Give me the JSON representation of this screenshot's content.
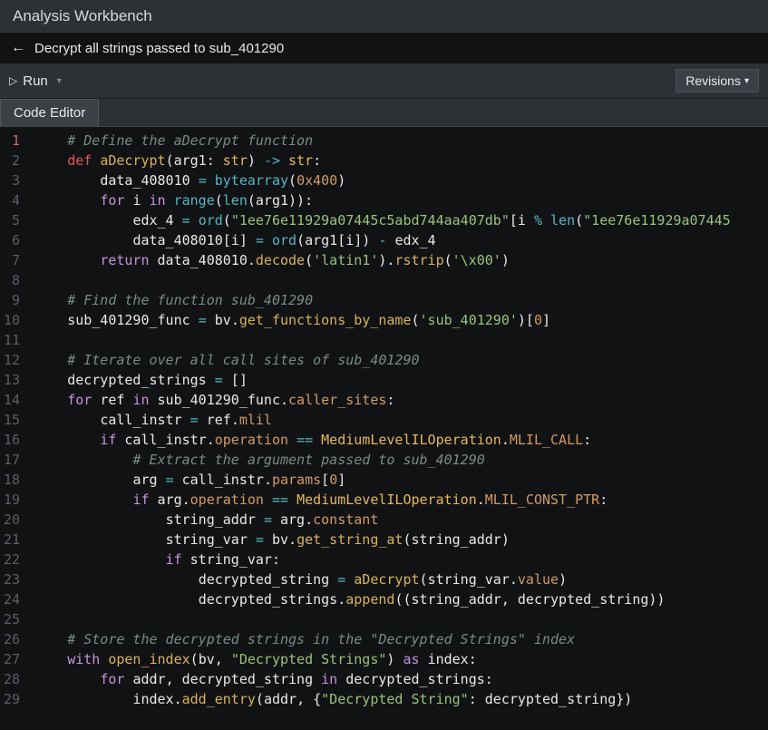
{
  "window": {
    "title": "Analysis Workbench"
  },
  "breadcrumb": {
    "text": "Decrypt all strings passed to sub_401290"
  },
  "toolbar": {
    "run_label": "Run",
    "revisions_label": "Revisions"
  },
  "tabs": {
    "code_editor": "Code Editor"
  },
  "code": {
    "lines": [
      {
        "n": 1,
        "tokens": [
          [
            "    ",
            ""
          ],
          [
            "# Define the aDecrypt function",
            "cmt"
          ]
        ]
      },
      {
        "n": 2,
        "tokens": [
          [
            "    ",
            ""
          ],
          [
            "def",
            "kw"
          ],
          [
            " ",
            ""
          ],
          [
            "aDecrypt",
            "fn"
          ],
          [
            "(",
            "pn"
          ],
          [
            "arg1",
            "nm"
          ],
          [
            ": ",
            "pn"
          ],
          [
            "str",
            "ty"
          ],
          [
            ") ",
            "pn"
          ],
          [
            "->",
            "op"
          ],
          [
            " ",
            ""
          ],
          [
            "str",
            "ty"
          ],
          [
            ":",
            "pn"
          ]
        ]
      },
      {
        "n": 3,
        "tokens": [
          [
            "        ",
            ""
          ],
          [
            "data_408010 ",
            "nm"
          ],
          [
            "=",
            "op"
          ],
          [
            " ",
            ""
          ],
          [
            "bytearray",
            "bi"
          ],
          [
            "(",
            "pn"
          ],
          [
            "0x400",
            "num"
          ],
          [
            ")",
            "pn"
          ]
        ]
      },
      {
        "n": 4,
        "tokens": [
          [
            "        ",
            ""
          ],
          [
            "for",
            "kw2"
          ],
          [
            " ",
            ""
          ],
          [
            "i",
            "nm"
          ],
          [
            " ",
            ""
          ],
          [
            "in",
            "kw2"
          ],
          [
            " ",
            ""
          ],
          [
            "range",
            "bi"
          ],
          [
            "(",
            "pn"
          ],
          [
            "len",
            "bi"
          ],
          [
            "(",
            "pn"
          ],
          [
            "arg1",
            "nm"
          ],
          [
            "))",
            "pn"
          ],
          [
            ":",
            "pn"
          ]
        ]
      },
      {
        "n": 5,
        "tokens": [
          [
            "            ",
            ""
          ],
          [
            "edx_4 ",
            "nm"
          ],
          [
            "=",
            "op"
          ],
          [
            " ",
            ""
          ],
          [
            "ord",
            "bi"
          ],
          [
            "(",
            "pn"
          ],
          [
            "\"1ee76e11929a07445c5abd744aa407db\"",
            "str"
          ],
          [
            "[",
            "pn"
          ],
          [
            "i ",
            "nm"
          ],
          [
            "%",
            "op"
          ],
          [
            " ",
            ""
          ],
          [
            "len",
            "bi"
          ],
          [
            "(",
            "pn"
          ],
          [
            "\"1ee76e11929a07445",
            "str"
          ]
        ]
      },
      {
        "n": 6,
        "tokens": [
          [
            "            ",
            ""
          ],
          [
            "data_408010",
            "nm"
          ],
          [
            "[",
            "pn"
          ],
          [
            "i",
            "nm"
          ],
          [
            "] ",
            "pn"
          ],
          [
            "=",
            "op"
          ],
          [
            " ",
            ""
          ],
          [
            "ord",
            "bi"
          ],
          [
            "(",
            "pn"
          ],
          [
            "arg1",
            "nm"
          ],
          [
            "[",
            "pn"
          ],
          [
            "i",
            "nm"
          ],
          [
            "]) ",
            "pn"
          ],
          [
            "-",
            "op"
          ],
          [
            " ",
            ""
          ],
          [
            "edx_4",
            "nm"
          ]
        ]
      },
      {
        "n": 7,
        "tokens": [
          [
            "        ",
            ""
          ],
          [
            "return",
            "kw2"
          ],
          [
            " ",
            ""
          ],
          [
            "data_408010",
            "nm"
          ],
          [
            ".",
            "pn"
          ],
          [
            "decode",
            "fn"
          ],
          [
            "(",
            "pn"
          ],
          [
            "'latin1'",
            "str"
          ],
          [
            ")",
            "pn"
          ],
          [
            ".",
            "pn"
          ],
          [
            "rstrip",
            "fn"
          ],
          [
            "(",
            "pn"
          ],
          [
            "'\\x00'",
            "str"
          ],
          [
            ")",
            "pn"
          ]
        ]
      },
      {
        "n": 8,
        "tokens": [
          [
            "",
            ""
          ]
        ]
      },
      {
        "n": 9,
        "tokens": [
          [
            "    ",
            ""
          ],
          [
            "# Find the function sub_401290",
            "cmt"
          ]
        ]
      },
      {
        "n": 10,
        "tokens": [
          [
            "    ",
            ""
          ],
          [
            "sub_401290_func ",
            "nm"
          ],
          [
            "=",
            "op"
          ],
          [
            " ",
            ""
          ],
          [
            "bv",
            "nm"
          ],
          [
            ".",
            "pn"
          ],
          [
            "get_functions_by_name",
            "fn"
          ],
          [
            "(",
            "pn"
          ],
          [
            "'sub_401290'",
            "str"
          ],
          [
            ")[",
            "pn"
          ],
          [
            "0",
            "num"
          ],
          [
            "]",
            "pn"
          ]
        ]
      },
      {
        "n": 11,
        "tokens": [
          [
            "",
            ""
          ]
        ]
      },
      {
        "n": 12,
        "tokens": [
          [
            "    ",
            ""
          ],
          [
            "# Iterate over all call sites of sub_401290",
            "cmt"
          ]
        ]
      },
      {
        "n": 13,
        "tokens": [
          [
            "    ",
            ""
          ],
          [
            "decrypted_strings ",
            "nm"
          ],
          [
            "=",
            "op"
          ],
          [
            " []",
            "pn"
          ]
        ]
      },
      {
        "n": 14,
        "tokens": [
          [
            "    ",
            ""
          ],
          [
            "for",
            "kw2"
          ],
          [
            " ",
            ""
          ],
          [
            "ref",
            "nm"
          ],
          [
            " ",
            ""
          ],
          [
            "in",
            "kw2"
          ],
          [
            " ",
            ""
          ],
          [
            "sub_401290_func",
            "nm"
          ],
          [
            ".",
            "pn"
          ],
          [
            "caller_sites",
            "att"
          ],
          [
            ":",
            "pn"
          ]
        ]
      },
      {
        "n": 15,
        "tokens": [
          [
            "        ",
            ""
          ],
          [
            "call_instr ",
            "nm"
          ],
          [
            "=",
            "op"
          ],
          [
            " ",
            ""
          ],
          [
            "ref",
            "nm"
          ],
          [
            ".",
            "pn"
          ],
          [
            "mlil",
            "att"
          ]
        ]
      },
      {
        "n": 16,
        "tokens": [
          [
            "        ",
            ""
          ],
          [
            "if",
            "kw2"
          ],
          [
            " ",
            ""
          ],
          [
            "call_instr",
            "nm"
          ],
          [
            ".",
            "pn"
          ],
          [
            "operation",
            "att"
          ],
          [
            " ",
            ""
          ],
          [
            "==",
            "op"
          ],
          [
            " ",
            ""
          ],
          [
            "MediumLevelILOperation",
            "cls"
          ],
          [
            ".",
            "pn"
          ],
          [
            "MLIL_CALL",
            "att"
          ],
          [
            ":",
            "pn"
          ]
        ]
      },
      {
        "n": 17,
        "tokens": [
          [
            "            ",
            ""
          ],
          [
            "# Extract the argument passed to sub_401290",
            "cmt"
          ]
        ]
      },
      {
        "n": 18,
        "tokens": [
          [
            "            ",
            ""
          ],
          [
            "arg ",
            "nm"
          ],
          [
            "=",
            "op"
          ],
          [
            " ",
            ""
          ],
          [
            "call_instr",
            "nm"
          ],
          [
            ".",
            "pn"
          ],
          [
            "params",
            "att"
          ],
          [
            "[",
            "pn"
          ],
          [
            "0",
            "num"
          ],
          [
            "]",
            "pn"
          ]
        ]
      },
      {
        "n": 19,
        "tokens": [
          [
            "            ",
            ""
          ],
          [
            "if",
            "kw2"
          ],
          [
            " ",
            ""
          ],
          [
            "arg",
            "nm"
          ],
          [
            ".",
            "pn"
          ],
          [
            "operation",
            "att"
          ],
          [
            " ",
            ""
          ],
          [
            "==",
            "op"
          ],
          [
            " ",
            ""
          ],
          [
            "MediumLevelILOperation",
            "cls"
          ],
          [
            ".",
            "pn"
          ],
          [
            "MLIL_CONST_PTR",
            "att"
          ],
          [
            ":",
            "pn"
          ]
        ]
      },
      {
        "n": 20,
        "tokens": [
          [
            "                ",
            ""
          ],
          [
            "string_addr ",
            "nm"
          ],
          [
            "=",
            "op"
          ],
          [
            " ",
            ""
          ],
          [
            "arg",
            "nm"
          ],
          [
            ".",
            "pn"
          ],
          [
            "constant",
            "att"
          ]
        ]
      },
      {
        "n": 21,
        "tokens": [
          [
            "                ",
            ""
          ],
          [
            "string_var ",
            "nm"
          ],
          [
            "=",
            "op"
          ],
          [
            " ",
            ""
          ],
          [
            "bv",
            "nm"
          ],
          [
            ".",
            "pn"
          ],
          [
            "get_string_at",
            "fn"
          ],
          [
            "(",
            "pn"
          ],
          [
            "string_addr",
            "nm"
          ],
          [
            ")",
            "pn"
          ]
        ]
      },
      {
        "n": 22,
        "tokens": [
          [
            "                ",
            ""
          ],
          [
            "if",
            "kw2"
          ],
          [
            " ",
            ""
          ],
          [
            "string_var",
            "nm"
          ],
          [
            ":",
            "pn"
          ]
        ]
      },
      {
        "n": 23,
        "tokens": [
          [
            "                    ",
            ""
          ],
          [
            "decrypted_string ",
            "nm"
          ],
          [
            "=",
            "op"
          ],
          [
            " ",
            ""
          ],
          [
            "aDecrypt",
            "fn"
          ],
          [
            "(",
            "pn"
          ],
          [
            "string_var",
            "nm"
          ],
          [
            ".",
            "pn"
          ],
          [
            "value",
            "att"
          ],
          [
            ")",
            "pn"
          ]
        ]
      },
      {
        "n": 24,
        "tokens": [
          [
            "                    ",
            ""
          ],
          [
            "decrypted_strings",
            "nm"
          ],
          [
            ".",
            "pn"
          ],
          [
            "append",
            "fn"
          ],
          [
            "((",
            "pn"
          ],
          [
            "string_addr",
            "nm"
          ],
          [
            ", ",
            "pn"
          ],
          [
            "decrypted_string",
            "nm"
          ],
          [
            "))",
            "pn"
          ]
        ]
      },
      {
        "n": 25,
        "tokens": [
          [
            "",
            ""
          ]
        ]
      },
      {
        "n": 26,
        "tokens": [
          [
            "    ",
            ""
          ],
          [
            "# Store the decrypted strings in the \"Decrypted Strings\" index",
            "cmt"
          ]
        ]
      },
      {
        "n": 27,
        "tokens": [
          [
            "    ",
            ""
          ],
          [
            "with",
            "kw2"
          ],
          [
            " ",
            ""
          ],
          [
            "open_index",
            "fn"
          ],
          [
            "(",
            "pn"
          ],
          [
            "bv",
            "nm"
          ],
          [
            ", ",
            "pn"
          ],
          [
            "\"Decrypted Strings\"",
            "str"
          ],
          [
            ") ",
            "pn"
          ],
          [
            "as",
            "kw2"
          ],
          [
            " ",
            ""
          ],
          [
            "index",
            "nm"
          ],
          [
            ":",
            "pn"
          ]
        ]
      },
      {
        "n": 28,
        "tokens": [
          [
            "        ",
            ""
          ],
          [
            "for",
            "kw2"
          ],
          [
            " ",
            ""
          ],
          [
            "addr",
            "nm"
          ],
          [
            ", ",
            "pn"
          ],
          [
            "decrypted_string",
            "nm"
          ],
          [
            " ",
            ""
          ],
          [
            "in",
            "kw2"
          ],
          [
            " ",
            ""
          ],
          [
            "decrypted_strings",
            "nm"
          ],
          [
            ":",
            "pn"
          ]
        ]
      },
      {
        "n": 29,
        "tokens": [
          [
            "            ",
            ""
          ],
          [
            "index",
            "nm"
          ],
          [
            ".",
            "pn"
          ],
          [
            "add_entry",
            "fn"
          ],
          [
            "(",
            "pn"
          ],
          [
            "addr",
            "nm"
          ],
          [
            ", {",
            "pn"
          ],
          [
            "\"Decrypted String\"",
            "str"
          ],
          [
            ": ",
            "pn"
          ],
          [
            "decrypted_string",
            "nm"
          ],
          [
            "})",
            "pn"
          ]
        ]
      }
    ]
  }
}
